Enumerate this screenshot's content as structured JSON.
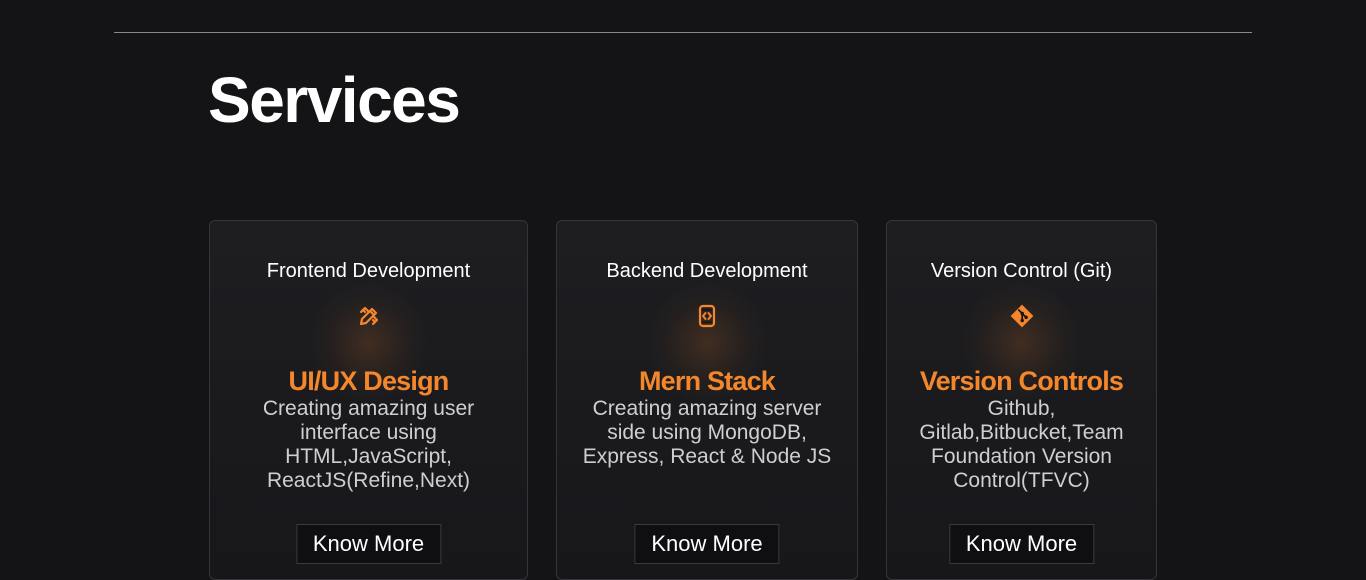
{
  "page": {
    "title": "Services"
  },
  "services": [
    {
      "heading": "Frontend Development",
      "icon": "pencil-ruler-icon",
      "subtitle": "UI/UX Design",
      "description": "Creating amazing user interface using HTML,JavaScript, ReactJS(Refine,Next)",
      "button_label": "Know More"
    },
    {
      "heading": "Backend Development",
      "icon": "code-device-icon",
      "subtitle": "Mern Stack",
      "description": "Creating amazing server side using MongoDB, Express, React & Node JS",
      "button_label": "Know More"
    },
    {
      "heading": "Version Control (Git)",
      "icon": "git-icon",
      "subtitle": "Version Controls",
      "description": "Github, Gitlab,Bitbucket,Team Foundation Version Control(TFVC)",
      "button_label": "Know More"
    }
  ],
  "colors": {
    "background": "#141416",
    "accent": "#f4862c",
    "text": "#ffffff",
    "muted_text": "#cfcfd2"
  }
}
